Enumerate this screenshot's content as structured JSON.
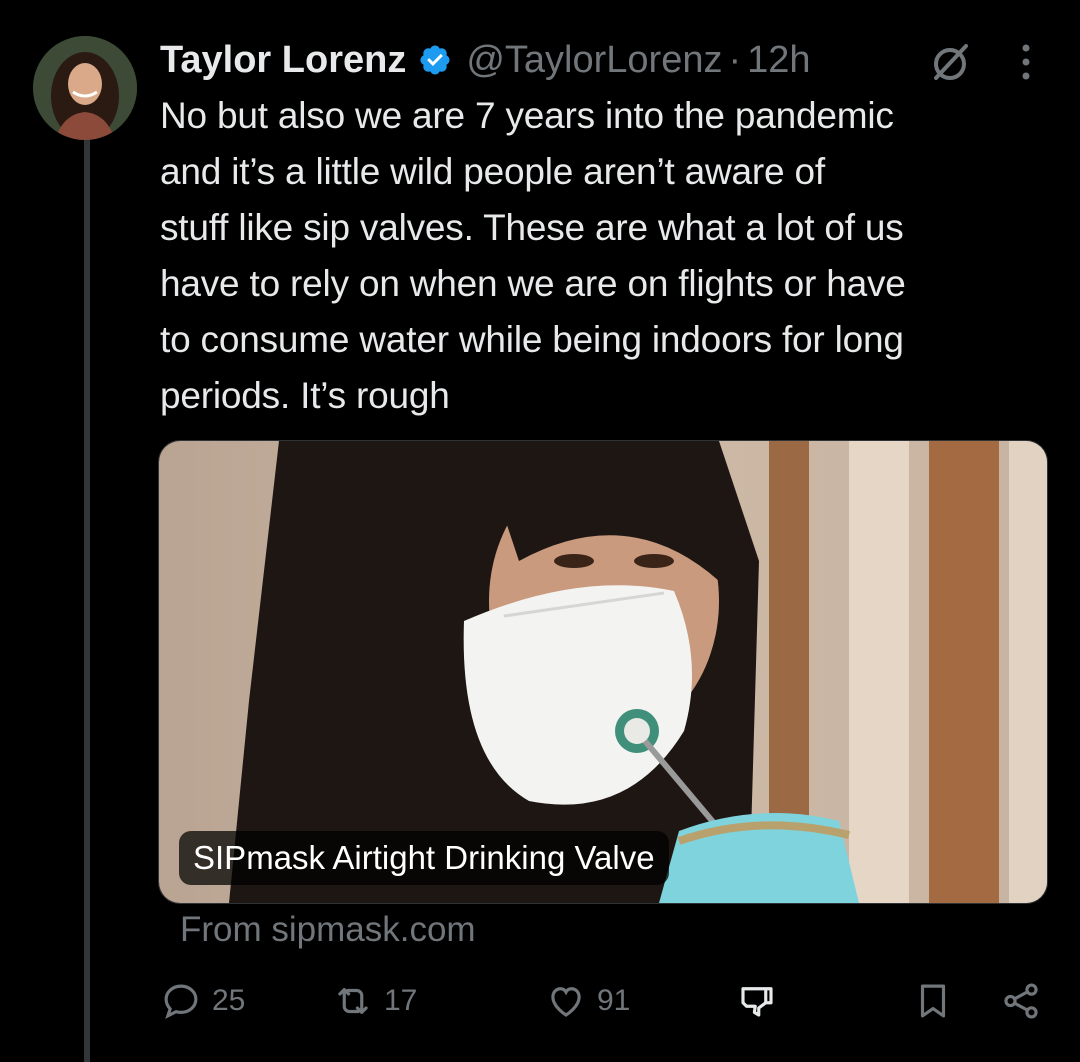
{
  "author": {
    "name": "Taylor Lorenz",
    "handle": "@TaylorLorenz",
    "separator": "·",
    "time": "12h",
    "verified": true
  },
  "tweet": {
    "text": "No but also we are 7 years into the pandemic\nand it’s a little wild people aren’t aware of\nstuff like sip valves. These are what a lot of us\nhave to rely on when we are on flights or have\nto consume water while being indoors for long\nperiods. It’s rough"
  },
  "card": {
    "title": "SIPmask Airtight Drinking Valve",
    "source": "From sipmask.com"
  },
  "actions": {
    "replies": "25",
    "reposts": "17",
    "likes": "91"
  },
  "icons": [
    "verified-badge-icon",
    "grok-icon",
    "more-icon",
    "reply-icon",
    "repost-icon",
    "like-icon",
    "downvote-icon",
    "bookmark-icon",
    "share-icon"
  ],
  "colors": {
    "background": "#000000",
    "text": "#e7e9ea",
    "muted": "#71767b",
    "verified": "#1d9bf0"
  }
}
